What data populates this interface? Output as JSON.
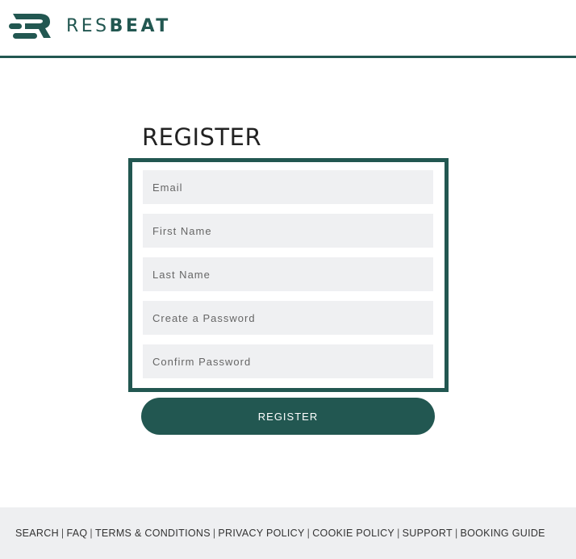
{
  "header": {
    "brand_prefix": "RES",
    "brand_suffix": "BEAT",
    "accent_color": "#225751"
  },
  "form": {
    "title": "REGISTER",
    "fields": [
      {
        "placeholder": "Email",
        "value": ""
      },
      {
        "placeholder": "First Name",
        "value": ""
      },
      {
        "placeholder": "Last Name",
        "value": ""
      },
      {
        "placeholder": "Create a Password",
        "value": ""
      },
      {
        "placeholder": "Confirm Password",
        "value": ""
      }
    ],
    "submit_label": "REGISTER"
  },
  "footer": {
    "links": [
      "SEARCH",
      "FAQ",
      "TERMS & CONDITIONS",
      "PRIVACY POLICY",
      "COOKIE POLICY",
      "SUPPORT",
      "BOOKING GUIDE"
    ],
    "separator": "|"
  }
}
